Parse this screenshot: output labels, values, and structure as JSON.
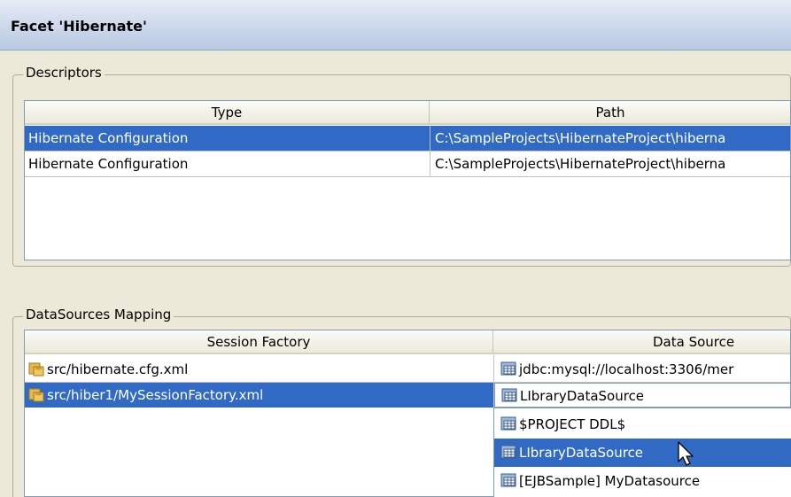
{
  "header": {
    "title": "Facet 'Hibernate'"
  },
  "descriptors": {
    "legend": "Descriptors",
    "columns": [
      "Type",
      "Path"
    ],
    "rows": [
      {
        "type": "Hibernate Configuration",
        "path": "C:\\SampleProjects\\HibernateProject\\hiberna",
        "selected": true
      },
      {
        "type": "Hibernate Configuration",
        "path": "C:\\SampleProjects\\HibernateProject\\hiberna",
        "selected": false
      }
    ]
  },
  "datasources": {
    "legend": "DataSources Mapping",
    "columns": [
      "Session Factory",
      "Data Source"
    ],
    "rows": [
      {
        "factory": "src/hibernate.cfg.xml",
        "source": "jdbc:mysql://localhost:3306/mer",
        "selected": false
      },
      {
        "factory": "src/hiber1/MySessionFactory.xml",
        "source": "LIbraryDataSource",
        "selected": true
      }
    ],
    "dropdown": [
      {
        "label": "$PROJECT DDL$",
        "selected": false
      },
      {
        "label": "LIbraryDataSource",
        "selected": true
      },
      {
        "label": "[EJBSample] MyDatasource",
        "selected": false
      }
    ]
  },
  "colors": {
    "selection": "#316ac5",
    "header_bg": "#c9d6ea",
    "panel_bg": "#ece9d8"
  },
  "icons": {
    "factory": "session-factory-icon",
    "datasource": "datasource-icon",
    "cursor": "mouse-pointer-icon"
  }
}
